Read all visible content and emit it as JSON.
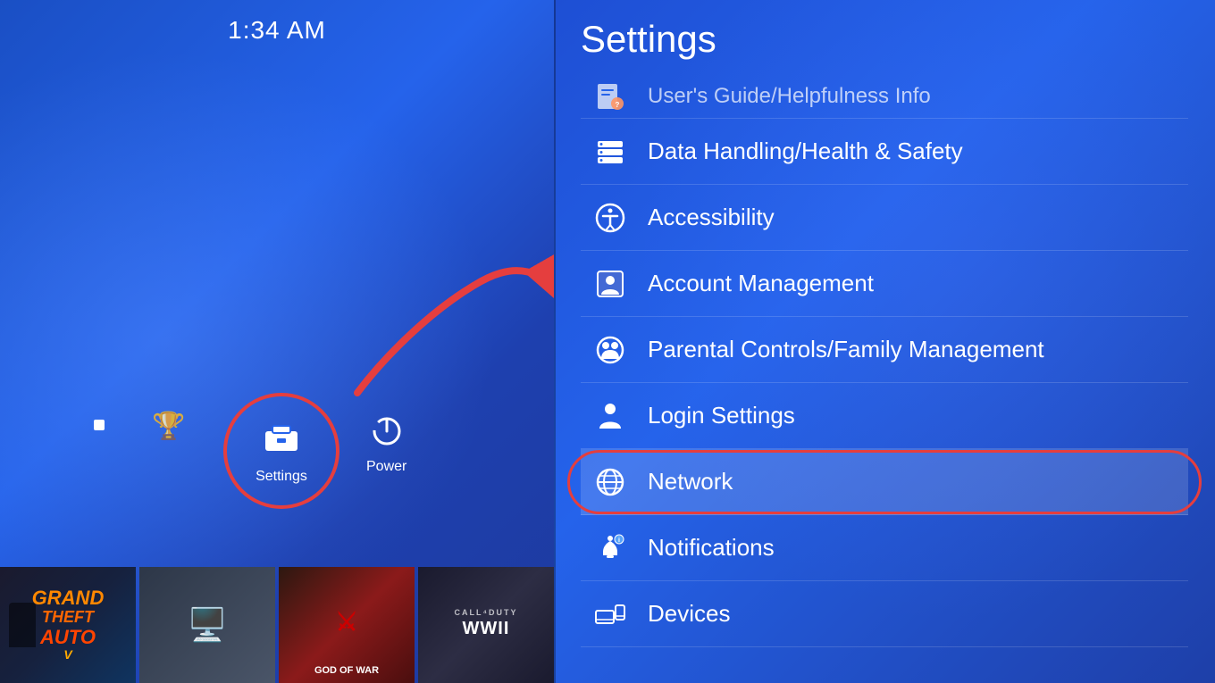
{
  "time": "1:34 AM",
  "leftPanel": {
    "settingsLabel": "Settings",
    "powerLabel": "Power",
    "gameThumbs": [
      {
        "id": "gta",
        "label": ""
      },
      {
        "id": "tv",
        "label": ""
      },
      {
        "id": "gow",
        "label": "GOD OF WAR"
      },
      {
        "id": "cod",
        "label": "CALL DUTY\nWWII"
      }
    ]
  },
  "rightPanel": {
    "title": "Settings",
    "menuItems": [
      {
        "id": "users-guide",
        "label": "User's Guide/Helpfulness Info",
        "icon": "guide"
      },
      {
        "id": "data-handling",
        "label": "Data Handling/Health & Safety",
        "icon": "data"
      },
      {
        "id": "accessibility",
        "label": "Accessibility",
        "icon": "accessibility"
      },
      {
        "id": "account-management",
        "label": "Account Management",
        "icon": "account"
      },
      {
        "id": "parental-controls",
        "label": "Parental Controls/Family Management",
        "icon": "parental"
      },
      {
        "id": "login-settings",
        "label": "Login Settings",
        "icon": "login"
      },
      {
        "id": "network",
        "label": "Network",
        "icon": "network",
        "highlighted": true
      },
      {
        "id": "notifications",
        "label": "Notifications",
        "icon": "notifications"
      },
      {
        "id": "devices",
        "label": "Devices",
        "icon": "devices"
      }
    ]
  },
  "colors": {
    "background": "#2563eb",
    "highlight": "#ffffff",
    "red": "#e53e3e",
    "text": "#ffffff"
  }
}
